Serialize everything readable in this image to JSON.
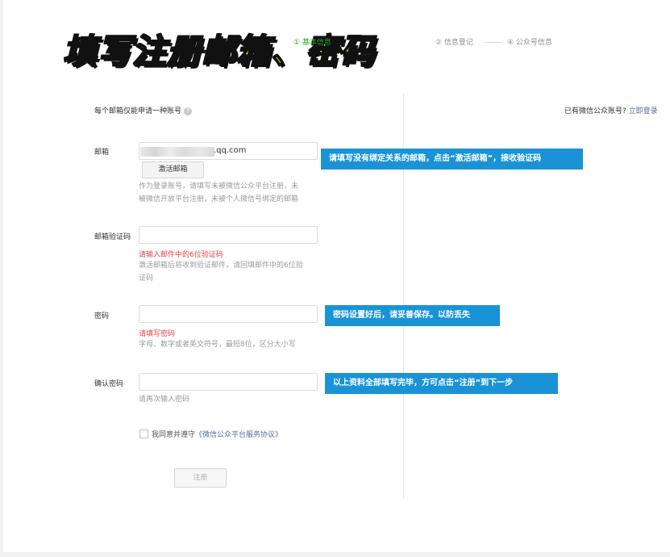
{
  "banner": {
    "title": "填写注册邮箱、密码"
  },
  "steps": [
    {
      "label": "① 基本信息"
    },
    {
      "label": "② 信息登记"
    },
    {
      "label": "④ 公众号信息"
    }
  ],
  "header": {
    "note": "每个邮箱仅能申请一种账号",
    "login_prompt": "已有微信公众账号?",
    "login_link": "立即登录"
  },
  "form": {
    "email": {
      "label": "邮箱",
      "value": ".qq.com",
      "activate_button": "激活邮箱",
      "tip_line1": "作为登录账号，请填写未被微信公众平台注册，未",
      "tip_line2": "被微信开放平台注册，未被个人微信号绑定的邮箱"
    },
    "code": {
      "label": "邮箱验证码",
      "error": "请输入邮件中的6位验证码",
      "tip_line1": "激活邮箱后将收到验证邮件，请回填邮件中的6位验",
      "tip_line2": "证码"
    },
    "password": {
      "label": "密码",
      "error": "请填写密码",
      "tip": "字母、数字或者英文符号，最短8位，区分大小写"
    },
    "confirm": {
      "label": "确认密码",
      "tip": "请再次输入密码"
    },
    "agreement": {
      "prefix": "我同意并遵守",
      "link": "《微信公众平台服务协议》"
    },
    "submit": "注册"
  },
  "callouts": {
    "email": "请填写没有绑定关系的邮箱，点击“激活邮箱”，接收验证码",
    "password": "密码设置好后，请妥善保存。以防丢失",
    "confirm": "以上资料全部填写完毕，方可点击“注册”到下一步"
  },
  "colors": {
    "accent_green": "#1aad19",
    "callout_blue": "#1a93d6",
    "error_red": "#e64340",
    "link_blue": "#576b95",
    "banner_yellow": "#ffe600"
  }
}
